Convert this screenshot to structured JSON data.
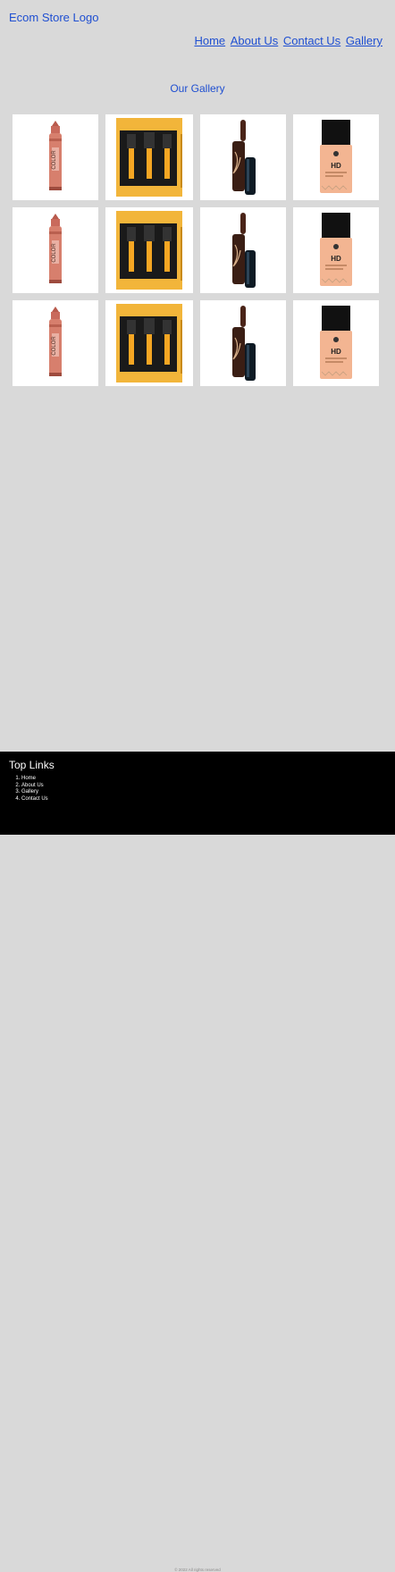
{
  "header": {
    "logo": "Ecom Store Logo",
    "nav": [
      "Home",
      "About Us",
      "Contact Us",
      "Gallery"
    ]
  },
  "gallery": {
    "title": "Our Gallery",
    "rows": [
      [
        "lipstick-crayon",
        "brush-set",
        "lip-gloss",
        "foundation"
      ],
      [
        "lipstick-crayon",
        "brush-set",
        "lip-gloss",
        "foundation"
      ],
      [
        "lipstick-crayon",
        "brush-set",
        "lip-gloss",
        "foundation"
      ]
    ]
  },
  "footer": {
    "title": "Top Links",
    "links": [
      "Home",
      "About Us",
      "Gallery",
      "Contact Us"
    ],
    "copyright": "© 2022 All rights reserved"
  },
  "colors": {
    "background": "#d9d9d9",
    "link": "#1f4fd1",
    "footer": "#000000"
  }
}
